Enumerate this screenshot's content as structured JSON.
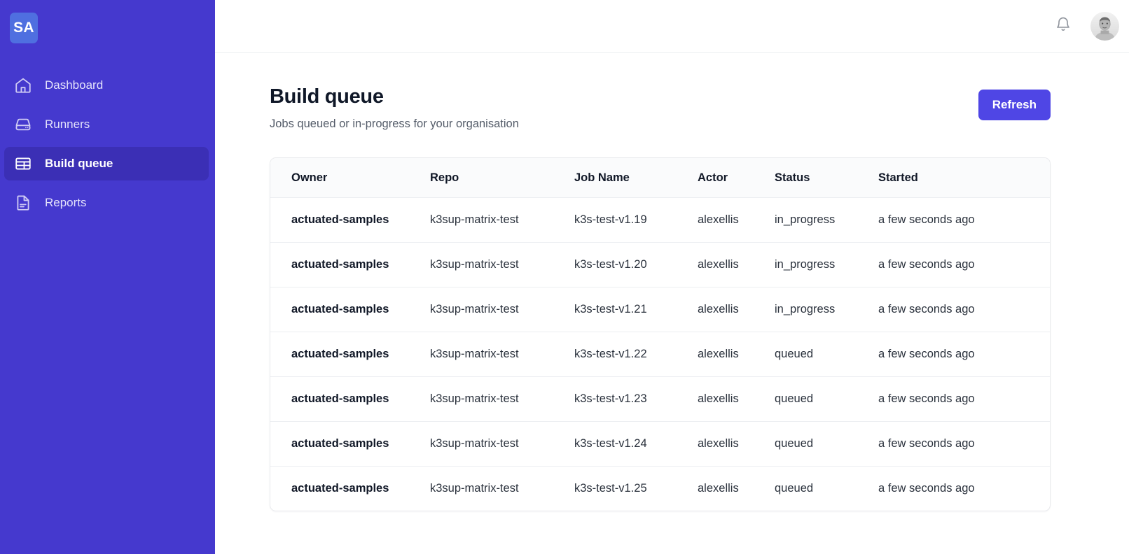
{
  "sidebar": {
    "brand": "SA",
    "items": [
      {
        "label": "Dashboard",
        "icon": "home-icon",
        "active": false
      },
      {
        "label": "Runners",
        "icon": "server-icon",
        "active": false
      },
      {
        "label": "Build queue",
        "icon": "table-icon",
        "active": true
      },
      {
        "label": "Reports",
        "icon": "document-icon",
        "active": false
      }
    ]
  },
  "topbar": {
    "notifications_icon": "bell-icon",
    "avatar": "user-avatar"
  },
  "page": {
    "title": "Build queue",
    "subtitle": "Jobs queued or in-progress for your organisation",
    "refresh_label": "Refresh"
  },
  "table": {
    "columns": [
      "Owner",
      "Repo",
      "Job Name",
      "Actor",
      "Status",
      "Started"
    ],
    "rows": [
      {
        "owner": "actuated-samples",
        "repo": "k3sup-matrix-test",
        "job": "k3s-test-v1.19",
        "actor": "alexellis",
        "status": "in_progress",
        "started": "a few seconds ago"
      },
      {
        "owner": "actuated-samples",
        "repo": "k3sup-matrix-test",
        "job": "k3s-test-v1.20",
        "actor": "alexellis",
        "status": "in_progress",
        "started": "a few seconds ago"
      },
      {
        "owner": "actuated-samples",
        "repo": "k3sup-matrix-test",
        "job": "k3s-test-v1.21",
        "actor": "alexellis",
        "status": "in_progress",
        "started": "a few seconds ago"
      },
      {
        "owner": "actuated-samples",
        "repo": "k3sup-matrix-test",
        "job": "k3s-test-v1.22",
        "actor": "alexellis",
        "status": "queued",
        "started": "a few seconds ago"
      },
      {
        "owner": "actuated-samples",
        "repo": "k3sup-matrix-test",
        "job": "k3s-test-v1.23",
        "actor": "alexellis",
        "status": "queued",
        "started": "a few seconds ago"
      },
      {
        "owner": "actuated-samples",
        "repo": "k3sup-matrix-test",
        "job": "k3s-test-v1.24",
        "actor": "alexellis",
        "status": "queued",
        "started": "a few seconds ago"
      },
      {
        "owner": "actuated-samples",
        "repo": "k3sup-matrix-test",
        "job": "k3s-test-v1.25",
        "actor": "alexellis",
        "status": "queued",
        "started": "a few seconds ago"
      }
    ]
  },
  "colors": {
    "sidebar": "#4539ce",
    "sidebar_active": "#3b2fb5",
    "brand_tile": "#4f6fe0",
    "accent": "#4f46e5",
    "text": "#111827",
    "muted": "#545c69",
    "border": "#eceef1",
    "header_bg": "#fafbfc"
  }
}
